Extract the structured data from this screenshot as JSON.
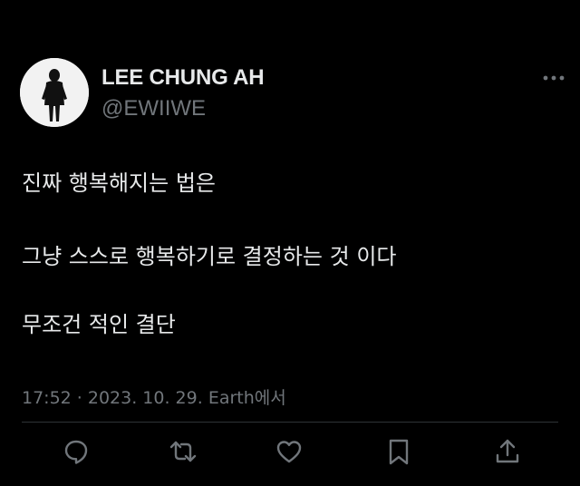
{
  "tweet": {
    "author": {
      "display_name": "LEE CHUNG AH",
      "handle": "@EWIIWE"
    },
    "text_lines": [
      "진짜 행복해지는 법은",
      "그냥 스스로 행복하기로 결정하는 것 이다",
      "무조건 적인 결단"
    ],
    "meta": "17:52 · 2023. 10. 29. Earth에서"
  },
  "icons": {
    "more": "more-horizontal-icon",
    "reply": "reply-icon",
    "retweet": "retweet-icon",
    "like": "heart-icon",
    "bookmark": "bookmark-icon",
    "share": "share-icon"
  },
  "colors": {
    "background": "#000000",
    "primary_text": "#e7e9ea",
    "secondary_text": "#71767b",
    "divider": "#2f3336"
  }
}
